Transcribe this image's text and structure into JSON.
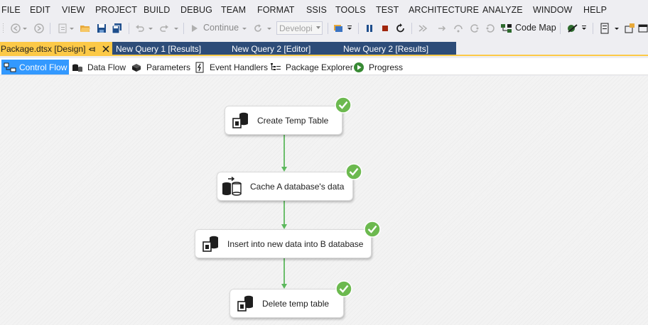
{
  "menu": {
    "file": "FILE",
    "edit": "EDIT",
    "view": "VIEW",
    "project": "PROJECT",
    "build": "BUILD",
    "debug": "DEBUG",
    "team": "TEAM",
    "format": "FORMAT",
    "ssis": "SSIS",
    "tools": "TOOLS",
    "test": "TEST",
    "architecture": "ARCHITECTURE",
    "analyze": "ANALYZE",
    "window": "WINDOW",
    "help": "HELP"
  },
  "toolbar": {
    "continue_label": "Continue",
    "config_value": "Developi",
    "codemap_label": "Code Map"
  },
  "doc_tabs": {
    "active": "Package.dtsx [Design]",
    "tab2": "New Query 1 [Results]",
    "tab3": "New Query 2 [Editor]",
    "tab4": "New Query 2 [Results]"
  },
  "designer_tabs": {
    "control_flow": "Control Flow",
    "data_flow": "Data Flow",
    "parameters": "Parameters",
    "event_handlers": "Event Handlers",
    "package_explorer": "Package Explorer",
    "progress": "Progress"
  },
  "tasks": {
    "t1": {
      "label": "Create Temp Table",
      "status": "succeeded"
    },
    "t2": {
      "label": "Cache A database's data",
      "status": "succeeded"
    },
    "t3": {
      "label": "Insert into new data into B database",
      "status": "succeeded"
    },
    "t4": {
      "label": "Delete temp table",
      "status": "succeeded"
    }
  },
  "colors": {
    "active_tab": "#fcc947",
    "inactive_tab": "#2d4c78",
    "selected_designer_tab": "#3399ff",
    "success_green": "#6cb94f",
    "connector_green": "#5cb85c"
  }
}
